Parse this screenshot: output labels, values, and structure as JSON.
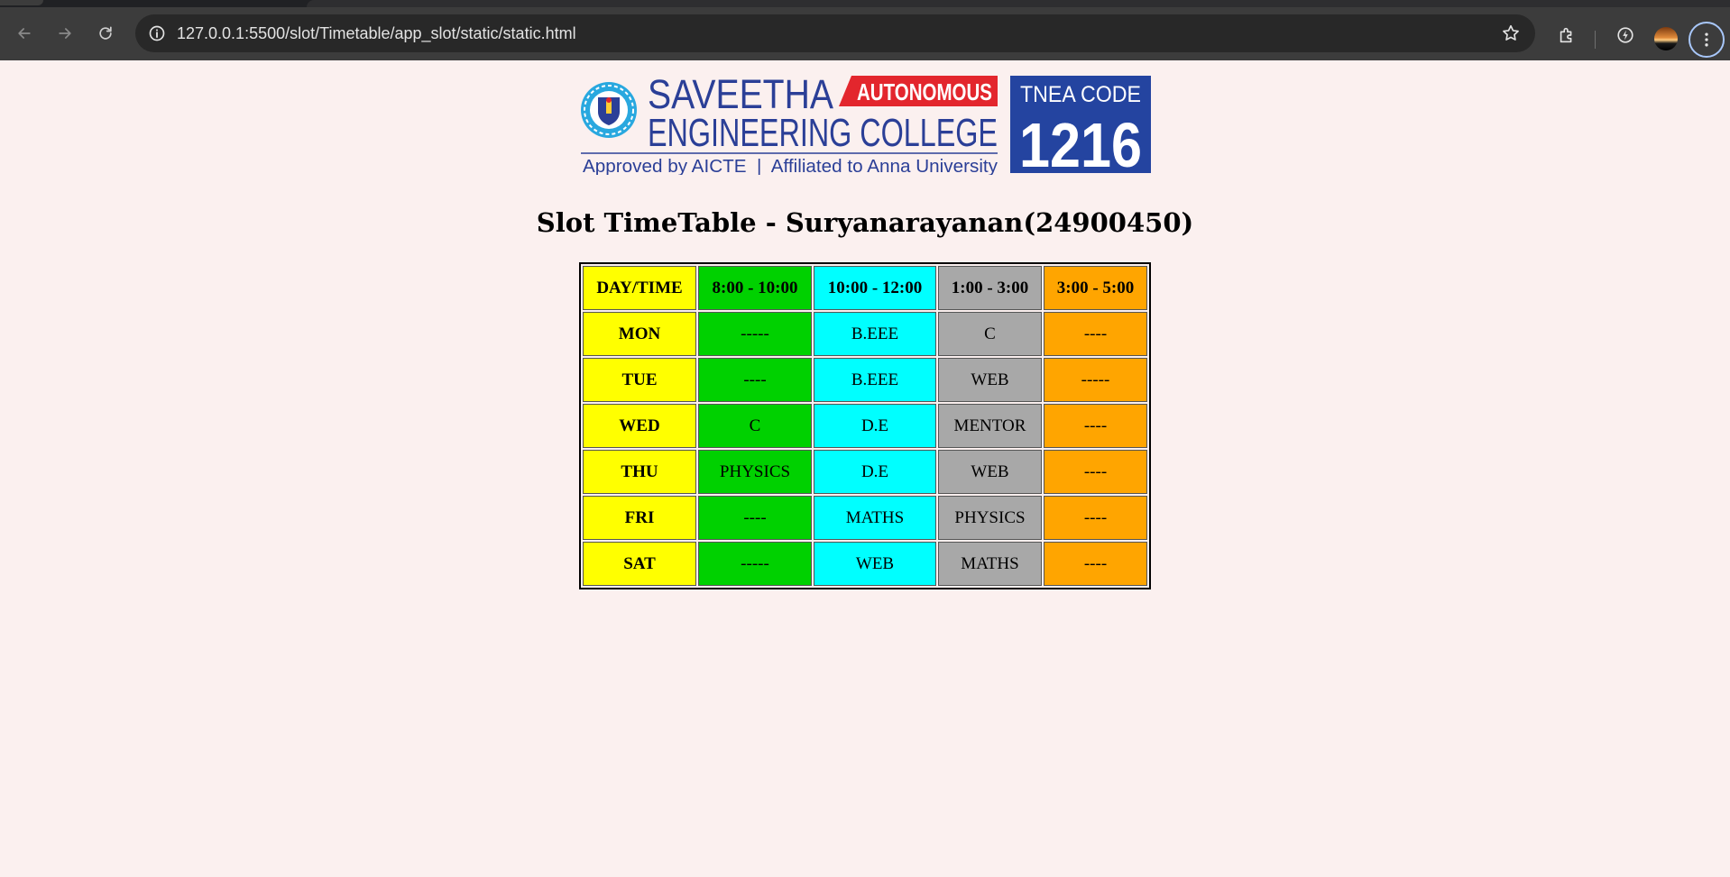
{
  "browser": {
    "url": "127.0.0.1:5500/slot/Timetable/app_slot/static/static.html"
  },
  "logo": {
    "college_line1": "SAVEETHA",
    "badge": "AUTONOMOUS",
    "college_line2": "ENGINEERING COLLEGE",
    "tagline": "Approved by AICTE  |  Affiliated to Anna University",
    "tnea_label": "TNEA CODE",
    "tnea_code": "1216",
    "colors": {
      "navy": "#2b3f97",
      "red": "#e3262d",
      "code_bg": "#2444a0"
    }
  },
  "page": {
    "title": "Slot TimeTable - Suryanarayanan(24900450)"
  },
  "timetable": {
    "headers": [
      "DAY/TIME",
      "8:00 - 10:00",
      "10:00 - 12:00",
      "1:00 - 3:00",
      "3:00 - 5:00"
    ],
    "rows": [
      {
        "day": "MON",
        "slots": [
          "-----",
          "B.EEE",
          "C",
          "----"
        ]
      },
      {
        "day": "TUE",
        "slots": [
          "----",
          "B.EEE",
          "WEB",
          "-----"
        ]
      },
      {
        "day": "WED",
        "slots": [
          "C",
          "D.E",
          "MENTOR",
          "----"
        ]
      },
      {
        "day": "THU",
        "slots": [
          "PHYSICS",
          "D.E",
          "WEB",
          "----"
        ]
      },
      {
        "day": "FRI",
        "slots": [
          "----",
          "MATHS",
          "PHYSICS",
          "----"
        ]
      },
      {
        "day": "SAT",
        "slots": [
          "-----",
          "WEB",
          "MATHS",
          "----"
        ]
      }
    ],
    "column_colors": [
      "#ffff00",
      "#00d100",
      "#00ffff",
      "#a8a8a8",
      "#ffa500"
    ]
  }
}
